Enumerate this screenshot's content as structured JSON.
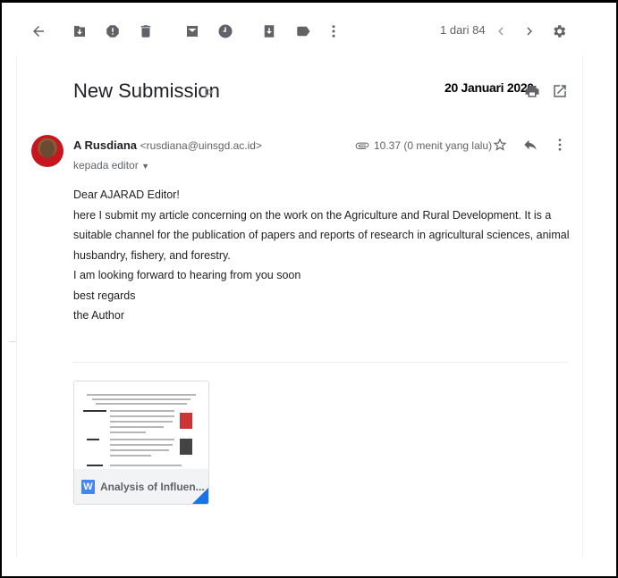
{
  "toolbar": {
    "back_icon": "arrow-back-icon",
    "pager": "1 dari 84",
    "prev_icon": "chevron-left-icon",
    "next_icon": "chevron-right-icon",
    "settings_icon": "gear-icon"
  },
  "message": {
    "subject": "New Submission",
    "date_stamp": "20 Januari 2020",
    "sender_name": "A Rusdiana",
    "sender_email": "<rusdiana@uinsgd.ac.id>",
    "recipient": "kepada editor",
    "time": "10.37 (0 menit yang lalu)",
    "body": [
      "Dear AJARAD Editor!",
      "here I submit my article concerning on the work on the Agriculture and Rural Development. It is a suitable channel for the publication of papers and reports of research in agricultural sciences, animal husbandry, fishery, and forestry.",
      "I am looking forward to hearing from you soon",
      "best regards",
      "the Author"
    ]
  },
  "attachment": {
    "type_letter": "W",
    "name": "Analysis of Influen..."
  },
  "colors": {
    "accent": "#1a73e8",
    "word_blue": "#4285f4",
    "icon_gray": "#5f6368"
  }
}
